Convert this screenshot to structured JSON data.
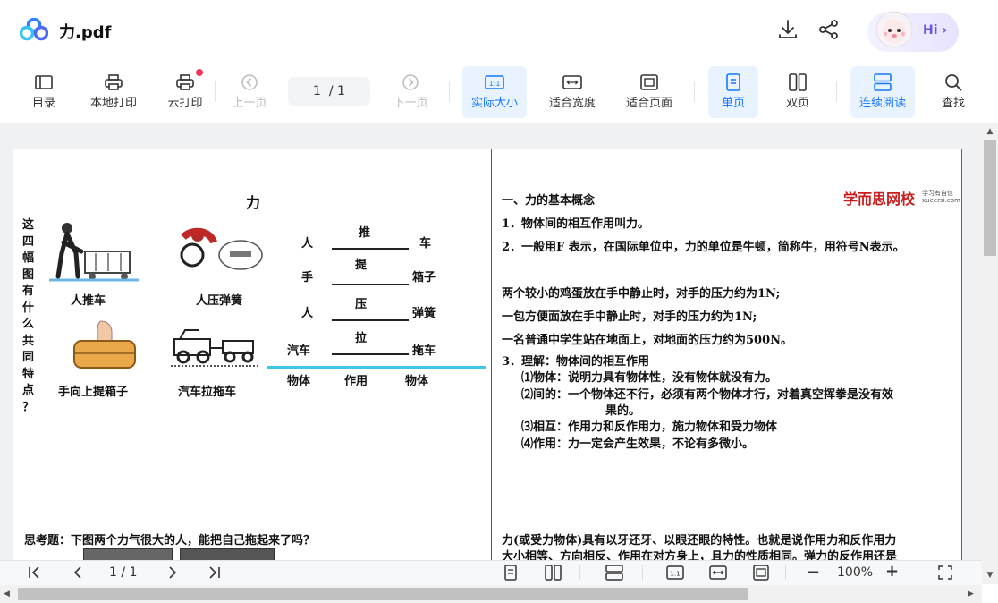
{
  "header": {
    "filename": "力.pdf",
    "hi_label": "Hi"
  },
  "toolbar": {
    "toc": "目录",
    "local_print": "本地打印",
    "cloud_print": "云打印",
    "prev_page": "上一页",
    "page_current": "1",
    "page_total": "/ 1",
    "next_page": "下一页",
    "actual_size": "实际大小",
    "fit_width": "适合宽度",
    "fit_page": "适合页面",
    "single": "单页",
    "double": "双页",
    "continuous": "连续阅读",
    "search": "查找",
    "actual_size_glyph": "1:1"
  },
  "bottom": {
    "page_current": "1",
    "page_total": "/ 1",
    "zoom": "100%",
    "minus": "−",
    "plus": "+",
    "ratio": "1:1"
  },
  "pdf": {
    "left_title": "力",
    "vertical_question": [
      "这",
      "四",
      "幅",
      "图",
      "有",
      "什",
      "么",
      "共",
      "同",
      "特",
      "点",
      "？"
    ],
    "captions": [
      "人推车",
      "人压弹簧",
      "手向上提箱子",
      "汽车拉拖车"
    ],
    "relations": [
      {
        "subject": "人",
        "verb": "推",
        "object": "车"
      },
      {
        "subject": "手",
        "verb": "提",
        "object": "箱子"
      },
      {
        "subject": "人",
        "verb": "压",
        "object": "弹簧"
      },
      {
        "subject": "汽车",
        "verb": "拉",
        "object": "拖车"
      }
    ],
    "table_footer": [
      "物体",
      "作用",
      "物体"
    ],
    "brand": "学而思网校",
    "brand_small1": "学习有自信",
    "brand_small2": "xueersi.com",
    "right_heading": "一、力的基本概念",
    "p1": "1．物体间的相互作用叫力。",
    "p2": "2．一般用F 表示，在国际单位中，力的单位是牛顿，简称牛，用符号N表示。",
    "ex1": "两个较小的鸡蛋放在手中静止时，对手的压力约为1N;",
    "ex2": "一包方便面放在手中静止时，对手的压力约为1N;",
    "ex3": "一名普通中学生站在地面上，对地面的压力约为500N。",
    "p3": "3．理解：物体间的相互作用",
    "p3a": "⑴物体：说明力具有物体性，没有物体就没有力。",
    "p3b": "⑵间的：一个物体还不行，必须有两个物体才行，对着真空挥拳是没有效",
    "p3b2": "果的。",
    "p3c": "⑶相互：作用力和反作用力，施力物体和受力物体",
    "p3d": "⑷作用：力一定会产生效果，不论有多微小。",
    "think": "思考题：下图两个力气很大的人，能把自己拖起来了吗？",
    "right_bottom1": "力(或受力物体)具有以牙还牙、以眼还眼的特性。也就是说作用力和反作用力",
    "right_bottom2": "大小相等、方向相反、作用在对方身上，且力的性质相同。弹力的反作用还是"
  }
}
